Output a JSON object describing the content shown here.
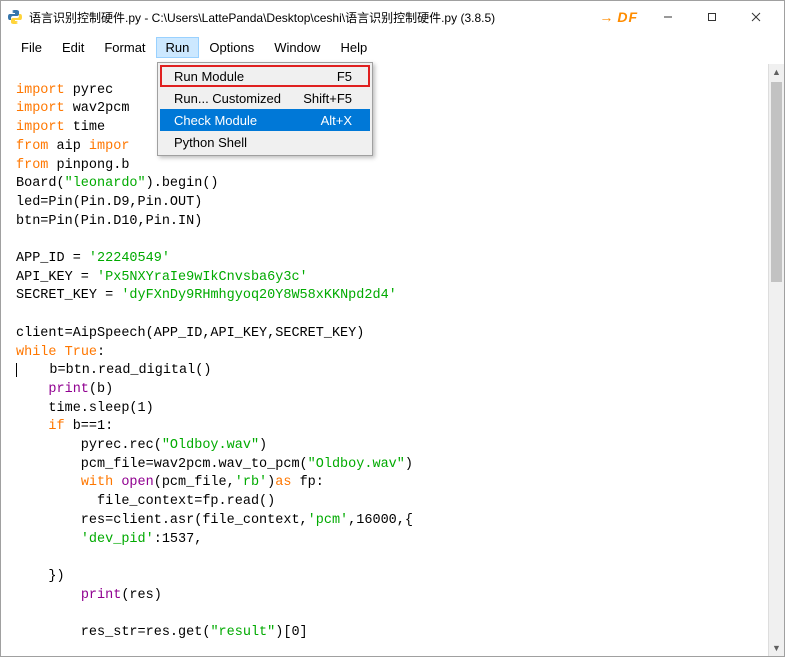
{
  "window": {
    "title": "语言识别控制硬件.py - C:\\Users\\LattePanda\\Desktop\\ceshi\\语言识别控制硬件.py (3.8.5)",
    "watermark": "DF",
    "arrow": "→"
  },
  "menu": {
    "items": [
      "File",
      "Edit",
      "Format",
      "Run",
      "Options",
      "Window",
      "Help"
    ],
    "active_index": 3
  },
  "run_menu": {
    "items": [
      {
        "label": "Run Module",
        "shortcut": "F5",
        "highlighted": true,
        "selected": false
      },
      {
        "label": "Run... Customized",
        "shortcut": "Shift+F5",
        "highlighted": false,
        "selected": false
      },
      {
        "label": "Check Module",
        "shortcut": "Alt+X",
        "highlighted": false,
        "selected": true
      },
      {
        "label": "Python Shell",
        "shortcut": "",
        "highlighted": false,
        "selected": false
      }
    ]
  },
  "code": {
    "l1a": "import",
    "l1b": " pyrec",
    "l2a": "import",
    "l2b": " wav2pcm",
    "l3a": "import",
    "l3b": " time",
    "l4a": "from",
    "l4b": " aip ",
    "l4c": "impor",
    "l5a": "from",
    "l5b": " pinpong.b",
    "l6": "Board(",
    "l6s": "\"leonardo\"",
    "l6e": ").begin()",
    "l7": "led=Pin(Pin.D9,Pin.OUT)",
    "l8": "btn=Pin(Pin.D10,Pin.IN)",
    "l10a": "APP_ID = ",
    "l10s": "'22240549'",
    "l11a": "API_KEY = ",
    "l11s": "'Px5NXYraIe9wIkCnvsba6y3c'",
    "l12a": "SECRET_KEY = ",
    "l12s": "'dyFXnDy9RHmhgyoq20Y8W58xKKNpd2d4'",
    "l14": "client=AipSpeech(APP_ID,API_KEY,SECRET_KEY)",
    "l15a": "while",
    "l15b": " ",
    "l15c": "True",
    "l15d": ":",
    "l16": "    b=btn.read_digital()",
    "l17a": "    ",
    "l17b": "print",
    "l17c": "(b)",
    "l18": "    time.sleep(1)",
    "l19a": "    ",
    "l19b": "if",
    "l19c": " b==1:",
    "l20a": "        pyrec.rec(",
    "l20s": "\"Oldboy.wav\"",
    "l20e": ")",
    "l21a": "        pcm_file=wav2pcm.wav_to_pcm(",
    "l21s": "\"Oldboy.wav\"",
    "l21e": ")",
    "l22a": "        ",
    "l22b": "with",
    "l22c": " ",
    "l22d": "open",
    "l22e": "(pcm_file,",
    "l22s": "'rb'",
    "l22f": ")",
    "l22g": "as",
    "l22h": " fp:",
    "l23": "          file_context=fp.read()",
    "l24a": "        res=client.asr(file_context,",
    "l24s": "'pcm'",
    "l24b": ",16000,{",
    "l25a": "        ",
    "l25s": "'dev_pid'",
    "l25b": ":1537,",
    "l27": "    })",
    "l28a": "        ",
    "l28b": "print",
    "l28c": "(res)",
    "l30a": "        res_str=res.get(",
    "l30s": "\"result\"",
    "l30b": ")[0]"
  }
}
